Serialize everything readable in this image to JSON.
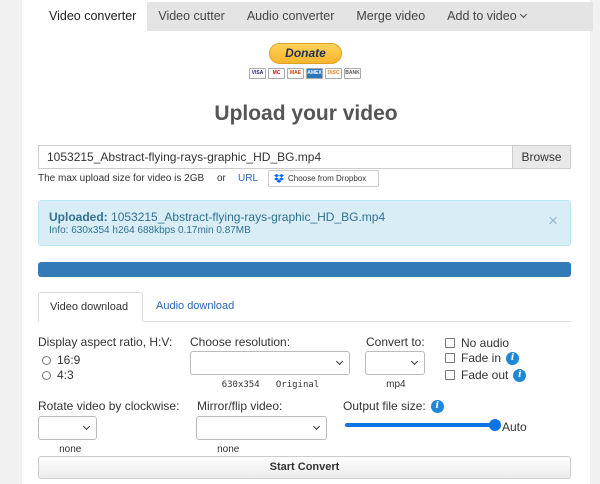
{
  "nav": {
    "tabs": [
      {
        "label": "Video converter"
      },
      {
        "label": "Video cutter"
      },
      {
        "label": "Audio converter"
      },
      {
        "label": "Merge video"
      },
      {
        "label": "Add to video"
      }
    ]
  },
  "donate": {
    "label": "Donate",
    "cards": [
      "VISA",
      "MC",
      "MAE",
      "AMEX",
      "DISC",
      "BANK"
    ]
  },
  "title": "Upload your video",
  "upload": {
    "file_value": "1053215_Abstract-flying-rays-graphic_HD_BG.mp4",
    "browse_label": "Browse",
    "max_size": "The max upload size for video is 2GB",
    "or": "or",
    "url_label": "URL",
    "dropbox_label": "Choose from Dropbox"
  },
  "uploaded": {
    "prefix": "Uploaded:",
    "filename": "1053215_Abstract-flying-rays-graphic_HD_BG.mp4",
    "info": "Info: 630x354   h264   688kbps   0.17min   0.87MB",
    "close": "×"
  },
  "progress": {
    "value": 1.0,
    "color": "#337ab7"
  },
  "download_tabs": {
    "video": "Video download",
    "audio": "Audio download"
  },
  "options": {
    "aspect_label": "Display aspect ratio, H:V:",
    "aspect_options": [
      "16:9",
      "4:3"
    ],
    "resolution_label": "Choose resolution:",
    "resolution_value": "630x354   Original",
    "convert_label": "Convert to:",
    "convert_value": "mp4",
    "no_audio": "No audio",
    "fade_in": "Fade in",
    "fade_out": "Fade out",
    "rotate_label": "Rotate video by clockwise:",
    "rotate_value": "none",
    "mirror_label": "Mirror/flip video:",
    "mirror_value": "none",
    "size_label": "Output file size:",
    "size_value": "Auto",
    "size_slider_level": 1.0
  },
  "start_label": "Start Convert",
  "colors": {
    "accent": "#337ab7",
    "link": "#2a66b5",
    "info_bg": "#d9edf7",
    "slider": "#0d74e6"
  }
}
